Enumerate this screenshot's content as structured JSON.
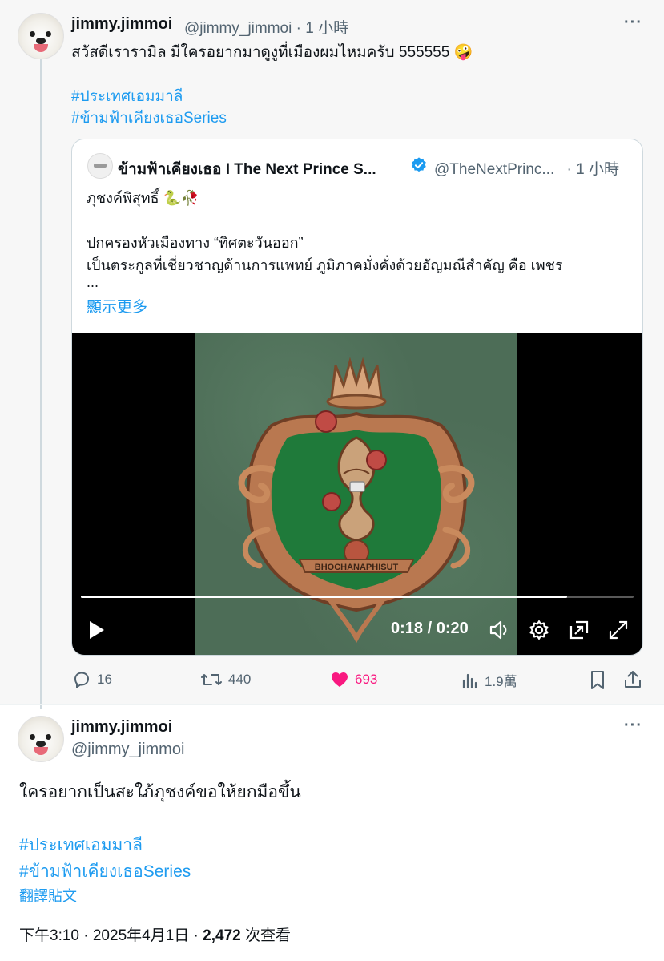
{
  "parent": {
    "name": "jimmy.jimmoi",
    "handle": "@jimmy_jimmoi",
    "time": "· 1 小時",
    "text": "สวัสดีเรารามิล มีใครอยากมาดูงูที่เมืองผมไหมครับ 555555 🤪",
    "hashtags": [
      "#ประเทศเอมมาลี",
      "#ข้ามฟ้าเคียงเธอSeries"
    ],
    "quote": {
      "name": "ข้ามฟ้าเคียงเธอ I The Next Prince S...",
      "handle": "@TheNextPrinc...",
      "time": "· 1 小時",
      "line1": "ภุชงค์พิสุทธิ์ 🐍🥀",
      "line2": "ปกครองหัวเมืองทาง “ทิศตะวันออก”",
      "line3": "เป็นตระกูลที่เชี่ยวชาญด้านการแพทย์ ภูมิภาคมั่งคั่งด้วยอัญมณีสำคัญ คือ เพชร",
      "ellipsis": "...",
      "show_more": "顯示更多",
      "video": {
        "time": "0:18 / 0:20",
        "progress": 0.88,
        "banner": "BHOCHANAPHISUT"
      }
    },
    "actions": {
      "replies": "16",
      "retweets": "440",
      "likes": "693",
      "views": "1.9萬"
    }
  },
  "main": {
    "name": "jimmy.jimmoi",
    "handle": "@jimmy_jimmoi",
    "text": "ใครอยากเป็นสะใภ้ภุชงค์ขอให้ยกมือขึ้น",
    "hashtags": [
      "#ประเทศเอมมาลี",
      "#ข้ามฟ้าเคียงเธอSeries"
    ],
    "translate": "翻譯貼文",
    "timestamp": "下午3:10 · 2025年4月1日 · ",
    "views_count": "2,472",
    "views_label": " 次查看"
  },
  "colors": {
    "link": "#1d9bf0",
    "like": "#f91880",
    "muted": "#536471"
  }
}
